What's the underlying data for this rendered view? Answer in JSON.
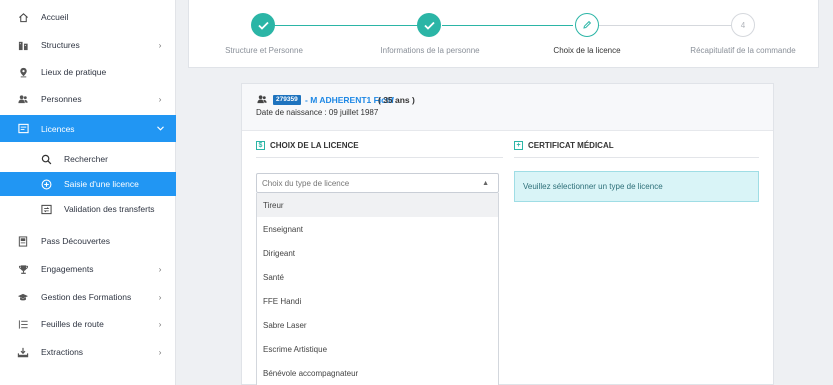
{
  "sidebar": {
    "items": [
      {
        "label": "Accueil",
        "icon": "home-icon",
        "has_chevron": false
      },
      {
        "label": "Structures",
        "icon": "structures-icon",
        "has_chevron": true
      },
      {
        "label": "Lieux de pratique",
        "icon": "location-pin-icon",
        "has_chevron": false
      },
      {
        "label": "Personnes",
        "icon": "people-icon",
        "has_chevron": true
      },
      {
        "label": "Licences",
        "icon": "licence-card-icon",
        "has_chevron": true,
        "active": true
      },
      {
        "label": "Pass Découvertes",
        "icon": "pass-icon",
        "has_chevron": false
      },
      {
        "label": "Engagements",
        "icon": "trophy-icon",
        "has_chevron": true
      },
      {
        "label": "Gestion des Formations",
        "icon": "graduation-cap-icon",
        "has_chevron": true
      },
      {
        "label": "Feuilles de route",
        "icon": "list-icon",
        "has_chevron": true
      },
      {
        "label": "Extractions",
        "icon": "download-icon",
        "has_chevron": true
      }
    ],
    "licences_sub": [
      {
        "label": "Rechercher",
        "icon": "search-icon"
      },
      {
        "label": "Saisie d'une licence",
        "icon": "plus-circle-icon",
        "active": true
      },
      {
        "label": "Validation des transferts",
        "icon": "transfer-icon"
      }
    ]
  },
  "stepper": {
    "steps": [
      {
        "label": "Structure et Personne",
        "state": "done"
      },
      {
        "label": "Informations de la personne",
        "state": "done"
      },
      {
        "label": "Choix de la licence",
        "state": "current"
      },
      {
        "label": "Récapitulatif de la commande",
        "state": "todo",
        "number": "4"
      }
    ]
  },
  "person": {
    "id": "279359",
    "name": "- M ADHERENT1 Fictif",
    "age": "( 35 ans )",
    "dob": "Date de naissance : 09 juillet 1987"
  },
  "licence_section": {
    "title": "CHOIX DE LA LICENCE",
    "select_placeholder": "Choix du type de licence",
    "options": [
      "Tireur",
      "Enseignant",
      "Dirigeant",
      "Santé",
      "FFE Handi",
      "Sabre Laser",
      "Escrime Artistique",
      "Bénévole accompagnateur"
    ]
  },
  "certificat_section": {
    "title": "CERTIFICAT MÉDICAL",
    "info": "Veuillez sélectionner un type de licence"
  },
  "colors": {
    "primary": "#2196f3",
    "step_done": "#2bb5a6",
    "info_bg": "#d9f4f7"
  }
}
